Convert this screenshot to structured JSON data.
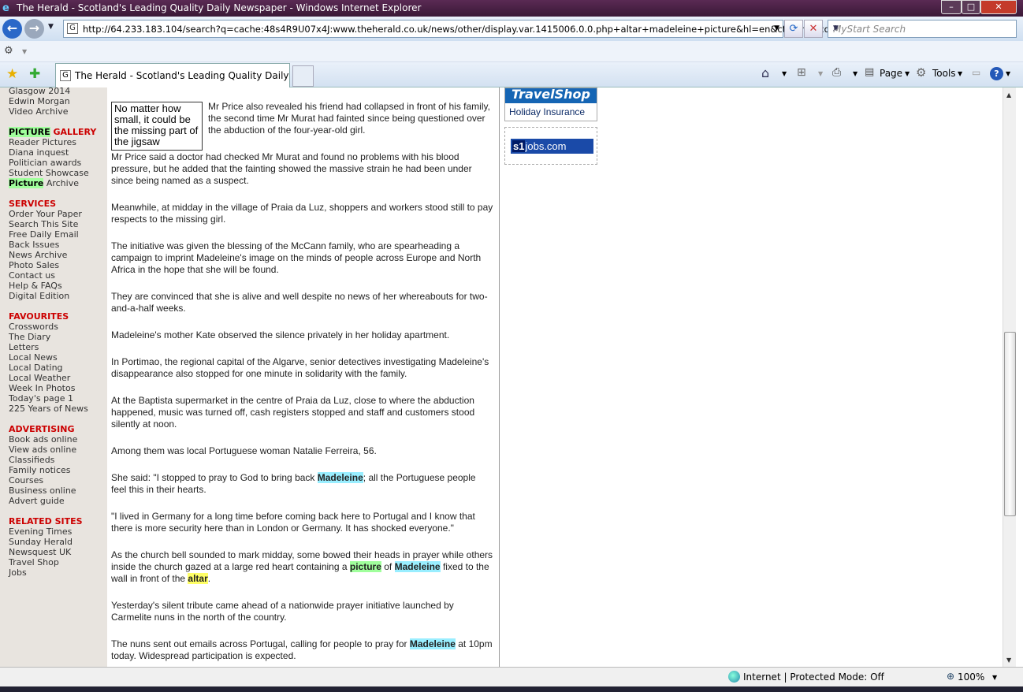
{
  "window": {
    "title": "The Herald - Scotland's Leading Quality Daily Newspaper - Windows Internet Explorer",
    "min": "–",
    "max": "□",
    "close": "✕"
  },
  "nav": {
    "back_icon": "←",
    "forward_icon": "→",
    "url": "http://64.233.183.104/search?q=cache:48s4R9U07x4J:www.theherald.co.uk/news/other/display.var.1415006.0.0.php+altar+madeleine+picture&hl=en&ct=clnk&cd=1",
    "url_favicon": "G",
    "refresh_icon": "⟳",
    "stop_icon": "✕",
    "search_placeholder": "MyStart Search"
  },
  "tab": {
    "favicon": "G",
    "label": "The Herald - Scotland's Leading Quality Daily Ne..."
  },
  "toolbar": {
    "page_label": "Page",
    "tools_label": "Tools"
  },
  "leftnav": {
    "top_items": [
      "Glasgow 2014",
      "Edwin Morgan",
      "Video Archive"
    ],
    "picture_gallery": {
      "heading_highlight": "PICTURE",
      "heading_rest": " GALLERY",
      "items": [
        "Reader Pictures",
        "Diana inquest",
        "Politician awards",
        "Student Showcase"
      ],
      "archive_highlight": "Picture",
      "archive_rest": " Archive"
    },
    "services": {
      "heading": "SERVICES",
      "items": [
        "Order Your Paper",
        "Search This Site",
        "Free Daily Email",
        "Back Issues",
        "News Archive",
        "Photo Sales",
        "Contact us",
        "Help & FAQs",
        "Digital Edition"
      ]
    },
    "favourites": {
      "heading": "FAVOURITES",
      "items": [
        "Crosswords",
        "The Diary",
        "Letters",
        "Local News",
        "Local Dating",
        "Local Weather",
        "Week In Photos",
        "Today's page 1",
        "225 Years of News"
      ]
    },
    "advertising": {
      "heading": "ADVERTISING",
      "items": [
        "Book ads online",
        "View ads online",
        "Classifieds",
        "Family notices",
        "Courses",
        "Business online",
        "Advert guide"
      ]
    },
    "related": {
      "heading": "RELATED SITES",
      "items": [
        "Evening Times",
        "Sunday Herald",
        "Newsquest UK",
        "Travel Shop",
        "Jobs"
      ]
    }
  },
  "article": {
    "pullquote": "No matter how small, it could be the missing part of the jigsaw",
    "p1": "Mr Price also revealed his friend had collapsed in front of his family, the second time Mr Murat had fainted since being questioned over the abduction of the four-year-old girl.",
    "p2": "Mr Price said a doctor had checked Mr Murat and found no problems with his blood pressure, but he added that the fainting showed the massive strain he had been under since being named as a suspect.",
    "p3": "Meanwhile, at midday in the village of Praia da Luz, shoppers and workers stood still to pay respects to the missing girl.",
    "p4": "The initiative was given the blessing of the McCann family, who are spearheading a campaign to imprint Madeleine's image on the minds of people across Europe and North Africa in the hope that she will be found.",
    "p5": "They are convinced that she is alive and well despite no news of her whereabouts for two-and-a-half weeks.",
    "p6": "Madeleine's mother Kate observed the silence privately in her holiday apartment.",
    "p7": "In Portimao, the regional capital of the Algarve, senior detectives investigating Madeleine's disappearance also stopped for one minute in solidarity with the family.",
    "p8": "At the Baptista supermarket in the centre of Praia da Luz, close to where the abduction happened, music was turned off, cash registers stopped and staff and customers stood silently at noon.",
    "p9": "Among them was local Portuguese woman Natalie Ferreira, 56.",
    "p10_a": "She said: \"I stopped to pray to God to bring back ",
    "p10_hl": "Madeleine",
    "p10_b": "; all the Portuguese people feel this in their hearts.",
    "p11": "\"I lived in Germany for a long time before coming back here to Portugal and I know that there is more security here than in London or Germany. It has shocked everyone.\"",
    "p12_a": "As the church bell sounded to mark midday, some bowed their heads in prayer while others inside the church gazed at a large red heart containing a ",
    "p12_hl1": "picture",
    "p12_b": " of ",
    "p12_hl2": "Madeleine",
    "p12_c": " fixed to the wall in front of the ",
    "p12_hl3": "altar",
    "p12_d": ".",
    "p13": "Yesterday's silent tribute came ahead of a nationwide prayer initiative launched by Carmelite nuns in the north of the country.",
    "p14_a": "The nuns sent out emails across Portugal, calling for people to pray for ",
    "p14_hl": "Madeleine",
    "p14_b": " at 10pm today. Widespread participation is expected."
  },
  "ads": {
    "travel_top": "TravelShop",
    "travel_bottom": "Holiday Insurance",
    "jobs_s1": "s1",
    "jobs_rest": "jobs.com"
  },
  "status": {
    "zone": "Internet | Protected Mode: Off",
    "zoom": "100%"
  }
}
